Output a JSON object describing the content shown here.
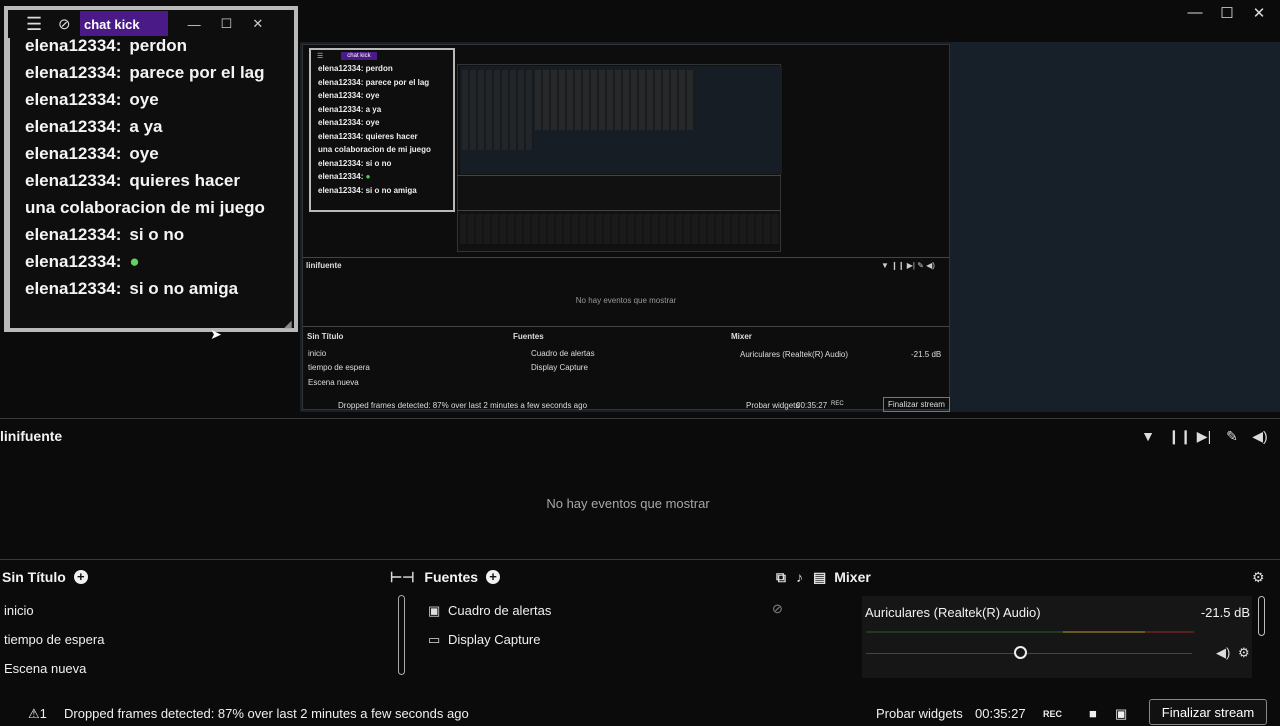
{
  "window": {
    "controls": [
      "—",
      "☐",
      "✕"
    ]
  },
  "chat": {
    "title": "chat kick",
    "controls": [
      "—",
      "☐",
      "✕"
    ],
    "messages": [
      {
        "user": "elena12334:",
        "text": "perdon"
      },
      {
        "user": "elena12334:",
        "text": "parece por el lag"
      },
      {
        "user": "elena12334:",
        "text": "oye"
      },
      {
        "user": "elena12334:",
        "text": "a ya"
      },
      {
        "user": "elena12334:",
        "text": "oye"
      },
      {
        "user": "elena12334:",
        "text": "quieres hacer"
      },
      {
        "user": "",
        "text": "una colaboracion de mi juego"
      },
      {
        "user": "elena12334:",
        "text": "si o no"
      },
      {
        "user": "elena12334:",
        "text": ""
      },
      {
        "user": "elena12334:",
        "text": "si o no amiga"
      }
    ]
  },
  "preview": {
    "mini_events_title": "linifuente",
    "mini_no_events": "No hay eventos que mostrar",
    "mini_scene_title": "Sin Título",
    "mini_sources_title": "Fuentes",
    "mini_mixer_title": "Mixer",
    "mini_scenes": [
      "inicio",
      "tiempo de espera",
      "Escena nueva"
    ],
    "mini_sources": [
      "Cuadro de alertas",
      "Display Capture"
    ],
    "mini_mixer_name": "Auriculares (Realtek(R) Audio)",
    "mini_mixer_db": "-21.5 dB",
    "mini_footer_warning": "Dropped frames detected: 87% over last 2 minutes a few seconds ago",
    "mini_probar": "Probar widgets",
    "mini_time": "00:35:27",
    "mini_rec": "REC",
    "mini_final": "Finalizar stream"
  },
  "events": {
    "title": "linifuente",
    "empty": "No hay eventos que mostrar"
  },
  "scenes": {
    "title": "Sin Título",
    "items": [
      "inicio",
      "tiempo de espera",
      "Escena nueva"
    ]
  },
  "sources": {
    "title": "Fuentes",
    "items": [
      "Cuadro de alertas",
      "Display Capture"
    ]
  },
  "mixer": {
    "title": "Mixer",
    "device": "Auriculares (Realtek(R) Audio)",
    "level": "-21.5 dB",
    "volume_fraction": 0.46
  },
  "footer": {
    "warning_count": "1",
    "warning": "Dropped frames detected: 87% over last 2 minutes a few seconds ago",
    "probar": "Probar widgets",
    "time": "00:35:27",
    "rec": "REC",
    "final": "Finalizar stream"
  },
  "colors": {
    "accent": "#4a1a86",
    "background": "#0b0b0b"
  }
}
